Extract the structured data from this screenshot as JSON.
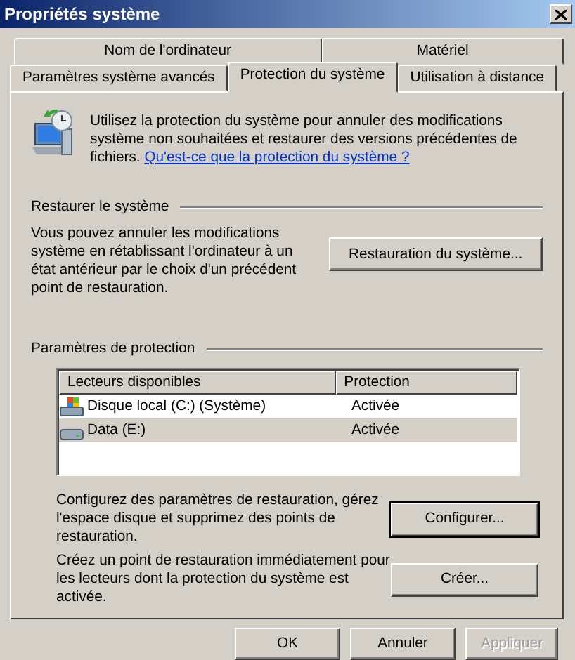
{
  "window": {
    "title": "Propriétés système"
  },
  "tab_rows": [
    [
      {
        "label": "Nom de l'ordinateur",
        "selected": false
      },
      {
        "label": "Matériel",
        "selected": false
      }
    ],
    [
      {
        "label": "Paramètres système avancés",
        "selected": false
      },
      {
        "label": "Protection du système",
        "selected": true
      },
      {
        "label": "Utilisation à distance",
        "selected": false
      }
    ]
  ],
  "intro": {
    "text": "Utilisez la protection du système pour annuler des modifications système non souhaitées et restaurer des versions précédentes de fichiers.",
    "link": "Qu'est-ce que la protection du système ?"
  },
  "restore_group": {
    "title": "Restaurer le système",
    "text": "Vous pouvez annuler les modifications système en rétablissant l'ordinateur à un état antérieur par le choix d'un précédent point de restauration.",
    "button": {
      "label": "Restauration du système...",
      "default": false
    }
  },
  "protection_group": {
    "title": "Paramètres de protection",
    "table": {
      "columns": [
        "Lecteurs disponibles",
        "Protection"
      ],
      "rows": [
        {
          "kind": "system-drive",
          "drive": "Disque local (C:) (Système)",
          "protection": "Activée",
          "selected": false
        },
        {
          "kind": "drive",
          "drive": "Data (E:)",
          "protection": "Activée",
          "selected": true
        }
      ]
    },
    "actions": [
      {
        "text": "Configurez des paramètres de restauration, gérez l'espace disque et supprimez des points de restauration.",
        "button": {
          "label": "Configurer...",
          "default": true
        }
      },
      {
        "text": "Créez un point de restauration immédiatement pour les lecteurs dont la protection du système est activée.",
        "button": {
          "label": "Créer...",
          "default": false
        }
      }
    ]
  },
  "buttons": [
    {
      "label": "OK",
      "disabled": false
    },
    {
      "label": "Annuler",
      "disabled": false
    },
    {
      "label": "Appliquer",
      "disabled": true
    }
  ]
}
